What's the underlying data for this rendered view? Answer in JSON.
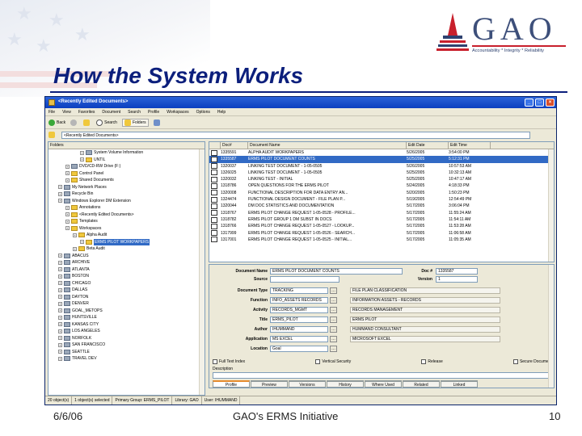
{
  "slide": {
    "title": "How the System Works",
    "logo_text": "GAO",
    "logo_tagline": "Accountability * Integrity * Reliability",
    "footer_date": "6/6/06",
    "footer_center": "GAO's ERMS Initiative",
    "footer_page": "10"
  },
  "colors": {
    "title": "#0c1f7c",
    "window_titlebar": "#0b3fbf",
    "selection": "#316ac5",
    "logo_red": "#c8202c"
  },
  "window": {
    "title": "<Recently Edited Documents>",
    "menu": [
      "File",
      "View",
      "Favorites",
      "Document",
      "Search",
      "Profile",
      "Workspaces",
      "Options",
      "Help"
    ],
    "toolbar": {
      "back": "Back",
      "search": "Search",
      "folders": "Folders"
    },
    "address_value": "<Recently Edited Documents>",
    "controls": {
      "minimize": "_",
      "maximize": "□",
      "close": "×"
    }
  },
  "tree": {
    "header": "Folders",
    "items": [
      {
        "indent": 4,
        "label": "System Volume Information",
        "type": "sys"
      },
      {
        "indent": 4,
        "label": "UNTIL",
        "type": "fold"
      },
      {
        "indent": 2,
        "label": "DVD/CD-RW Drive (F:)",
        "type": "sys"
      },
      {
        "indent": 2,
        "label": "Control Panel",
        "type": "fold"
      },
      {
        "indent": 2,
        "label": "Shared Documents",
        "type": "fold"
      },
      {
        "indent": 1,
        "label": "My Network Places",
        "type": "sys"
      },
      {
        "indent": 1,
        "label": "Recycle Bin",
        "type": "sys"
      },
      {
        "indent": 1,
        "label": "Windows Explorer DM Extension",
        "type": "sys"
      },
      {
        "indent": 2,
        "label": "Annotations",
        "type": "fold"
      },
      {
        "indent": 2,
        "label": "<Recently Edited Documents>",
        "type": "fold"
      },
      {
        "indent": 2,
        "label": "Templates",
        "type": "fold"
      },
      {
        "indent": 2,
        "label": "Workspaces",
        "type": "fold"
      },
      {
        "indent": 3,
        "label": "Alpha Audit",
        "type": "fold"
      },
      {
        "indent": 4,
        "label": "ERMS PILOT WORKPAPERS",
        "type": "fold",
        "selected": true
      },
      {
        "indent": 3,
        "label": "Beta Audit",
        "type": "fold"
      },
      {
        "indent": 1,
        "label": "ABACUS",
        "type": "sys"
      },
      {
        "indent": 1,
        "label": "ARCHIVE",
        "type": "sys"
      },
      {
        "indent": 1,
        "label": "ATLANTA",
        "type": "sys"
      },
      {
        "indent": 1,
        "label": "BOSTON",
        "type": "sys"
      },
      {
        "indent": 1,
        "label": "CHICAGO",
        "type": "sys"
      },
      {
        "indent": 1,
        "label": "DALLAS",
        "type": "sys"
      },
      {
        "indent": 1,
        "label": "DAYTON",
        "type": "sys"
      },
      {
        "indent": 1,
        "label": "DENVER",
        "type": "sys"
      },
      {
        "indent": 1,
        "label": "GOAL_METOPS",
        "type": "sys"
      },
      {
        "indent": 1,
        "label": "HUNTSVILLE",
        "type": "sys"
      },
      {
        "indent": 1,
        "label": "KANSAS CITY",
        "type": "sys"
      },
      {
        "indent": 1,
        "label": "LOS ANGELES",
        "type": "sys"
      },
      {
        "indent": 1,
        "label": "NORFOLK",
        "type": "sys"
      },
      {
        "indent": 1,
        "label": "SAN FRANCISCO",
        "type": "sys"
      },
      {
        "indent": 1,
        "label": "SEATTLE",
        "type": "sys"
      },
      {
        "indent": 1,
        "label": "TRAVEL DEV",
        "type": "sys"
      }
    ]
  },
  "list": {
    "columns": [
      "Doc#",
      "Document Name",
      "Edit Date",
      "Edit Time"
    ],
    "rows": [
      {
        "doc": "1335591",
        "name": "ALPHA AUDIT WORKPAPERS",
        "date": "5/26/2005",
        "time": "3:54:00 PM"
      },
      {
        "doc": "1335587",
        "name": "ERMS PILOT DOCUMENT COUNTS",
        "date": "5/25/2005",
        "time": "5:12:31 PM",
        "selected": true
      },
      {
        "doc": "1320037",
        "name": "LINKING TEST DOCUMENT - 1-05-0505",
        "date": "5/26/2005",
        "time": "10:57:53 AM"
      },
      {
        "doc": "1326025",
        "name": "LINKING TEST DOCUMENT - 1-05-0505",
        "date": "5/25/2005",
        "time": "10:32:13 AM"
      },
      {
        "doc": "1320032",
        "name": "LINKING TEST - INITIAL",
        "date": "5/25/2005",
        "time": "10:47:17 AM"
      },
      {
        "doc": "1318786",
        "name": "OPEN QUESTIONS FOR THE ERMS PILOT",
        "date": "5/24/2005",
        "time": "4:18:33 PM"
      },
      {
        "doc": "1320008",
        "name": "FUNCTIONAL DESCRIPTION FOR DATA ENTRY AN...",
        "date": "5/20/2005",
        "time": "1:50:23 PM"
      },
      {
        "doc": "1324474",
        "name": "FUNCTIONAL DESIGN DOCUMENT - FILE PLAN P...",
        "date": "5/19/2005",
        "time": "12:54:49 PM"
      },
      {
        "doc": "1320044",
        "name": "DM DOC STATISTICS AND DOCUMENTATION",
        "date": "5/17/2005",
        "time": "3:06:04 PM"
      },
      {
        "doc": "1318767",
        "name": "ERMS PILOT CHANGE REQUEST 1-05-0528 - PROFILE...",
        "date": "5/17/2005",
        "time": "11:55:24 AM"
      },
      {
        "doc": "1318782",
        "name": "ERMS PILOT GROUP 1 DM SUBST IN DOCS",
        "date": "5/17/2005",
        "time": "11:54:11 AM"
      },
      {
        "doc": "1318766",
        "name": "ERMS PILOT CHANGE REQUEST 1-05-0527 - LOOKUP...",
        "date": "5/17/2005",
        "time": "11:53:28 AM"
      },
      {
        "doc": "1317999",
        "name": "ERMS PILOT CHANGE REQUEST 1-05-0526 - SEARCH...",
        "date": "5/17/2005",
        "time": "11:06:58 AM"
      },
      {
        "doc": "1317001",
        "name": "ERMS PILOT CHANGE REQUEST 1-05-0525 - INITIAL...",
        "date": "5/17/2005",
        "time": "11:05:35 AM"
      }
    ]
  },
  "props": {
    "document_name_label": "Document Name",
    "document_name": "ERMS PILOT DOCUMENT COUNTS",
    "doc_no_label": "Doc #",
    "doc_no": "1335587",
    "source_label": "Source",
    "source": "",
    "version_label": "Version",
    "version": "1",
    "fields": [
      {
        "label": "Document Type",
        "value": "TRACKING",
        "desc": "FILE PLAN CLASSIFICATION"
      },
      {
        "label": "Function",
        "value": "INFO_ASSETS RECORDS",
        "desc": "INFORMATION ASSETS - RECORDS"
      },
      {
        "label": "Activity",
        "value": "RECORDS_MGMT",
        "desc": "RECORDS MANAGEMENT"
      },
      {
        "label": "Title",
        "value": "ERMS_PILOT",
        "desc": "ERMS PILOT"
      },
      {
        "label": "Author",
        "value": "IHUMMAND",
        "desc": "HUMMAND CONSULTANT"
      },
      {
        "label": "Application",
        "value": "MS EXCEL",
        "desc": "MICROSOFT EXCEL"
      },
      {
        "label": "Location",
        "value": "Goal",
        "desc": ""
      }
    ],
    "checks": [
      "Full Text Index",
      "Vertical Security",
      "Release",
      "Secure Document"
    ],
    "description_label": "Description",
    "tabs": [
      "Profile",
      "Preview",
      "Versions",
      "History",
      "Where Used",
      "Related",
      "Linked"
    ]
  },
  "status": [
    "20 object(s)",
    "1 object(s) selected",
    "Primary Group: ERMS_PILOT",
    "Library: GAO",
    "User: IHUMMAND"
  ]
}
